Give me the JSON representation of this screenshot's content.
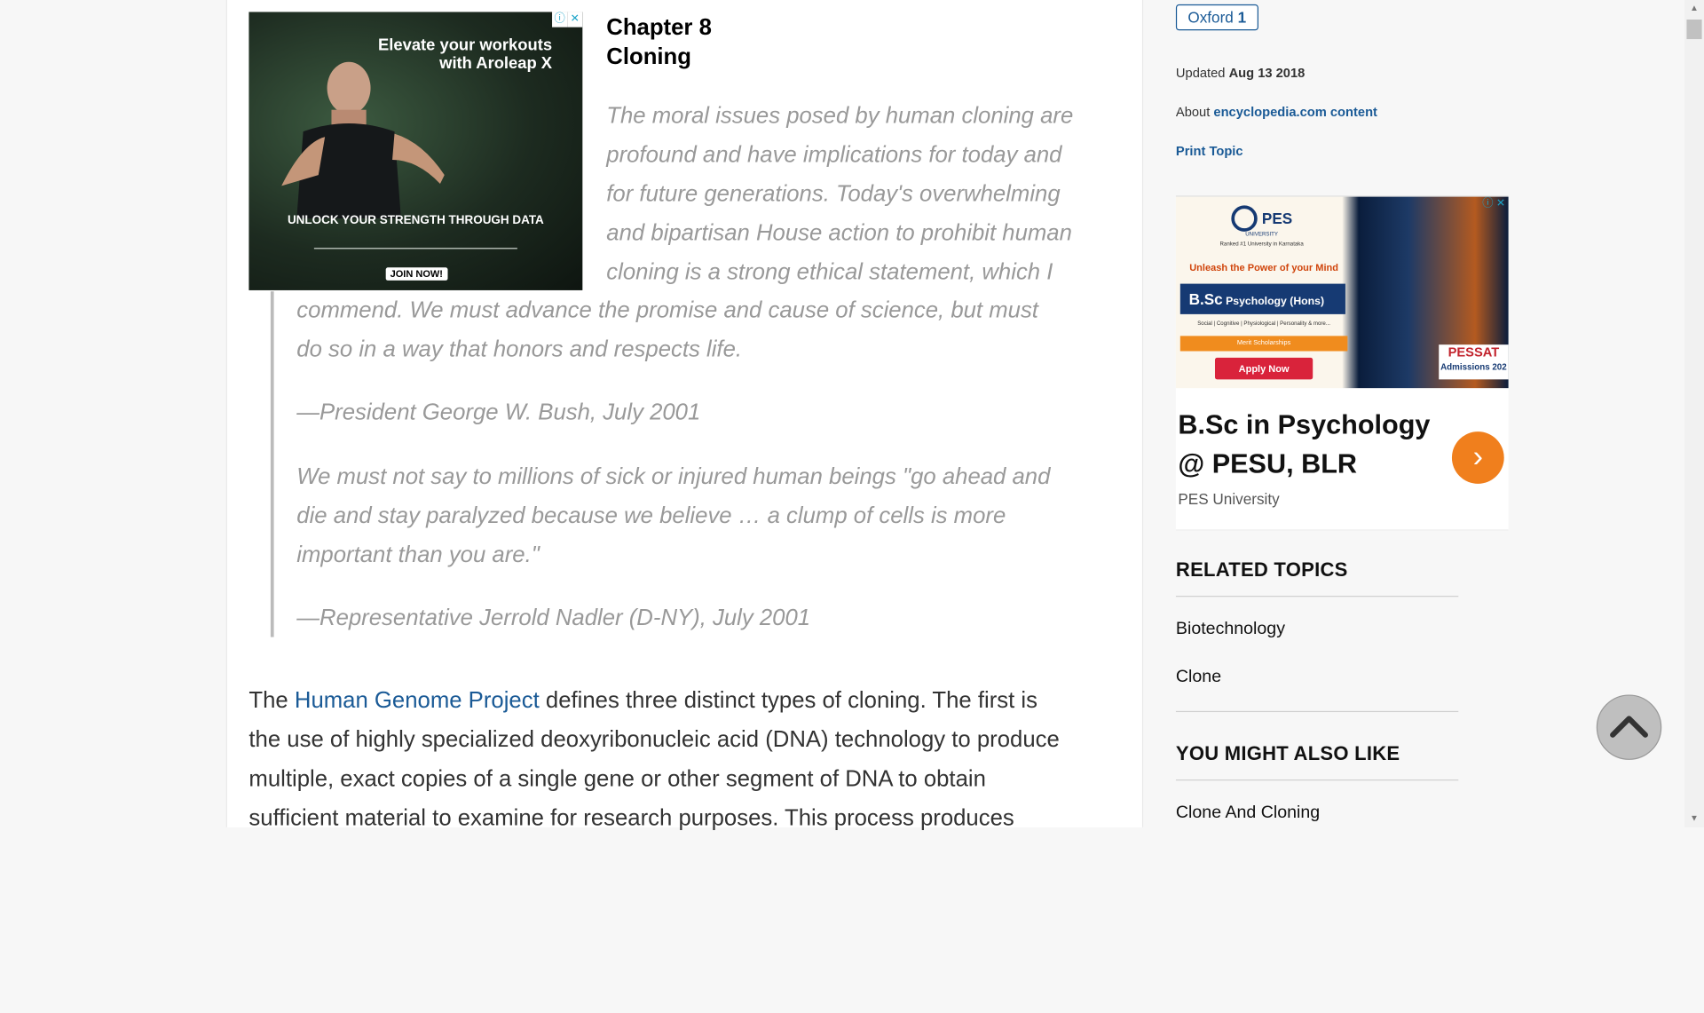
{
  "ad_top": {
    "headline": "Elevate your workouts with Aroleap X",
    "tagline": "UNLOCK YOUR STRENGTH THROUGH DATA",
    "cta": "JOIN NOW!",
    "adchoices": "ⓘ",
    "close": "✕"
  },
  "chapter": {
    "number": "Chapter 8",
    "title": "Cloning"
  },
  "epigraphs": [
    {
      "line1": "The moral issues posed by human cloning are",
      "line2": "profound and have implications for today and",
      "line3": "for future generations. Today's overwhelming",
      "line4": "and bipartisan House action to prohibit human",
      "line5": "cloning is a strong ethical statement, which I",
      "line6": "commend. We must advance the promise and cause of science, but must",
      "line7": "do so in a way that honors and respects life.",
      "attribution": "—President George W. Bush, July 2001"
    },
    {
      "line1": "We must not say to millions of sick or injured human beings \"go ahead and",
      "line2": "die and stay paralyzed because we believe … a clump of cells is more",
      "line3": "important than you are.\"",
      "attribution": "—Representative Jerrold Nadler (D-NY), July 2001"
    }
  ],
  "body": {
    "lead": "The",
    "link": "Human Genome Project",
    "line1_rest": "defines three distinct types of cloning. The first is",
    "line2": "the use of highly specialized deoxyribonucleic acid (DNA) technology to produce",
    "line3": "multiple, exact copies of a single gene or other segment of DNA to obtain",
    "line4": "sufficient material to examine for research purposes. This process produces"
  },
  "sidebar": {
    "source_badge": {
      "name": "Oxford",
      "count": "1"
    },
    "updated_label": "Updated",
    "updated_date": "Aug 13 2018",
    "about_label": "About",
    "about_link": "encyclopedia.com content",
    "print_link": "Print Topic"
  },
  "ad_side": {
    "university": "PES",
    "university_sub": "UNIVERSITY",
    "ranked": "Ranked #1 University in Karnataka",
    "unleash": "Unleash the Power of your Mind",
    "program_bold": "B.Sc",
    "program_rest": " Psychology (Hons)",
    "areas": "Social | Cognitive | Physiological | Personality & more...",
    "merit": "Merit Scholarships",
    "apply": "Apply Now",
    "pessat_a": "PESSAT",
    "pessat_b": "Admissions 202",
    "title_line1": "B.Sc in Psychology",
    "title_line2": "@ PESU, BLR",
    "source": "PES University",
    "adchoices": "ⓘ",
    "close": "✕"
  },
  "related": {
    "heading": "RELATED TOPICS",
    "items": [
      "Biotechnology",
      "Clone"
    ]
  },
  "also_like": {
    "heading": "YOU MIGHT ALSO LIKE",
    "items": [
      "Clone And Cloning"
    ]
  },
  "colors": {
    "link": "#1a5a96",
    "quote": "#999999",
    "accent_orange": "#f07f1d"
  }
}
